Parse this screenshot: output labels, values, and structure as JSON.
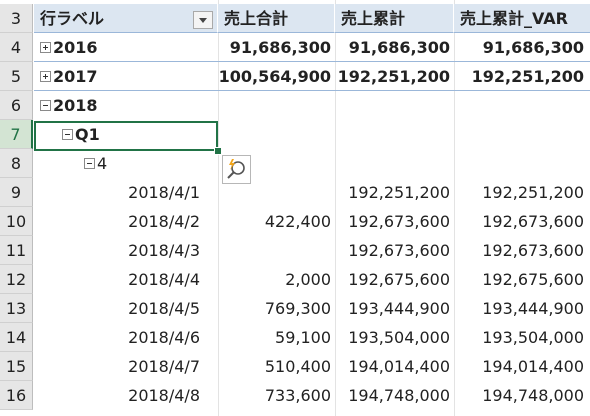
{
  "rows": [
    {
      "n": "3",
      "a": "行ラベル",
      "b": "売上合計",
      "c": "売上累計",
      "d": "売上累計_VAR",
      "type": "header"
    },
    {
      "n": "4",
      "a": "2016",
      "b": "91,686,300",
      "c": "91,686,300",
      "d": "91,686,300",
      "type": "year",
      "toggle": "plus"
    },
    {
      "n": "5",
      "a": "2017",
      "b": "100,564,900",
      "c": "192,251,200",
      "d": "192,251,200",
      "type": "year",
      "toggle": "plus"
    },
    {
      "n": "6",
      "a": "2018",
      "b": "",
      "c": "",
      "d": "",
      "type": "year2018",
      "toggle": "minus"
    },
    {
      "n": "7",
      "a": "Q1",
      "b": "",
      "c": "",
      "d": "",
      "type": "quarter",
      "toggle": "minus"
    },
    {
      "n": "8",
      "a": "4",
      "b": "",
      "c": "",
      "d": "",
      "type": "month",
      "toggle": "minus"
    },
    {
      "n": "9",
      "a": "2018/4/1",
      "b": "",
      "c": "192,251,200",
      "d": "192,251,200",
      "type": "day"
    },
    {
      "n": "10",
      "a": "2018/4/2",
      "b": "422,400",
      "c": "192,673,600",
      "d": "192,673,600",
      "type": "day"
    },
    {
      "n": "11",
      "a": "2018/4/3",
      "b": "",
      "c": "192,673,600",
      "d": "192,673,600",
      "type": "day"
    },
    {
      "n": "12",
      "a": "2018/4/4",
      "b": "2,000",
      "c": "192,675,600",
      "d": "192,675,600",
      "type": "day"
    },
    {
      "n": "13",
      "a": "2018/4/5",
      "b": "769,300",
      "c": "193,444,900",
      "d": "193,444,900",
      "type": "day"
    },
    {
      "n": "14",
      "a": "2018/4/6",
      "b": "59,100",
      "c": "193,504,000",
      "d": "193,504,000",
      "type": "day"
    },
    {
      "n": "15",
      "a": "2018/4/7",
      "b": "510,400",
      "c": "194,014,400",
      "d": "194,014,400",
      "type": "day"
    },
    {
      "n": "16",
      "a": "2018/4/8",
      "b": "733,600",
      "c": "194,748,000",
      "d": "194,748,000",
      "type": "day"
    }
  ],
  "active_row": "7",
  "colors": {
    "accent": "#217346",
    "header_fill": "#dce6f1",
    "row_header": "#e6e6e6"
  },
  "icons": {
    "filter": "filter-dropdown-icon",
    "quick_analysis": "quick-analysis-icon"
  }
}
